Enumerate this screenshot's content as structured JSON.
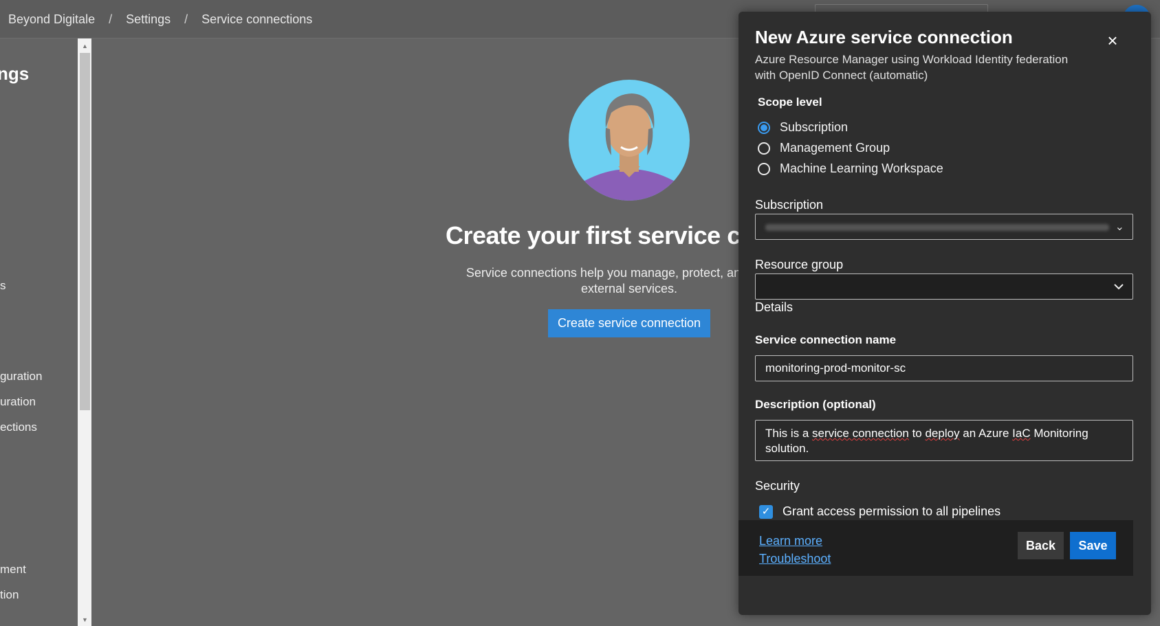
{
  "breadcrumb": {
    "org": "Beyond Digitale",
    "sep": "/",
    "settings": "Settings",
    "page": "Service connections"
  },
  "sidebar": {
    "title": "ngs",
    "items": [
      "s",
      "guration",
      "uration",
      "ections",
      "ment",
      "tion"
    ]
  },
  "empty_state": {
    "title": "Create your first service con",
    "description_line1": "Service connections help you manage, protect, and reuse a",
    "description_line2": "external services.",
    "button": "Create service connection"
  },
  "panel": {
    "title": "New Azure service connection",
    "subtitle_line1": "Azure Resource Manager using Workload Identity federation",
    "subtitle_line2": "with OpenID Connect (automatic)",
    "close_icon": "×",
    "scope_level_label": "Scope level",
    "scope_options": [
      "Subscription",
      "Management Group",
      "Machine Learning Workspace"
    ],
    "selected_scope": "Subscription",
    "subscription_label": "Subscription",
    "resource_group_label": "Resource group",
    "details_label": "Details",
    "name_label": "Service connection name",
    "name_value": "monitoring-prod-monitor-sc",
    "description_label": "Description (optional)",
    "description_value_a": "This is a ",
    "description_value_b": "service connection",
    "description_value_c": " to ",
    "description_value_d": "deploy",
    "description_value_e": " an Azure ",
    "description_value_f": "IaC",
    "description_value_g": " Monitoring solution.",
    "security_label": "Security",
    "grant_access_label": "Grant access permission to all pipelines",
    "grant_access_checked": true,
    "learn_more": "Learn more",
    "troubleshoot": "Troubleshoot",
    "back_button": "Back",
    "save_button": "Save"
  },
  "colors": {
    "accent": "#0f6fcf",
    "link": "#5cb0ff",
    "panel_bg": "#2e2e2e"
  }
}
